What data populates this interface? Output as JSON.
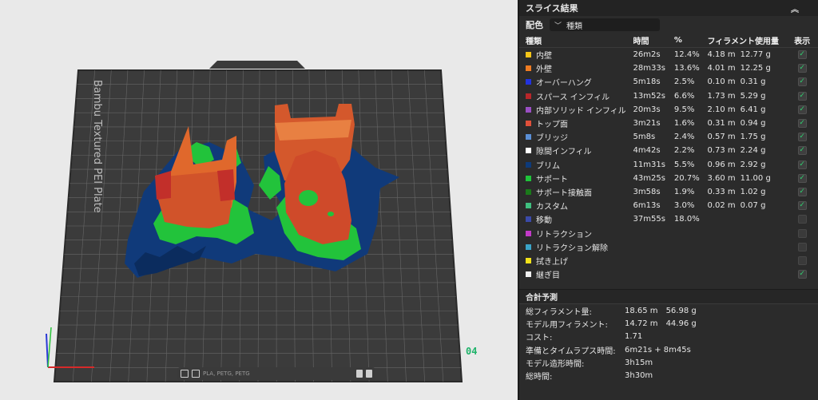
{
  "viewport": {
    "plate_label": "Bambu Textured PEI Plate",
    "plate_number": "04",
    "toolbar_text": "PLA, PETG, PETG"
  },
  "panel": {
    "title": "スライス結果",
    "scheme_label": "配色",
    "scheme_value": "種類",
    "headers": {
      "type": "種類",
      "time": "時間",
      "pct": "%",
      "filament": "フィラメント使用量",
      "show": "表示"
    },
    "rows": [
      {
        "name": "内壁",
        "color": "#f5c518",
        "time": "26m2s",
        "pct": "12.4%",
        "m": "4.18 m",
        "g": "12.77 g",
        "show": true
      },
      {
        "name": "外壁",
        "color": "#f07c22",
        "time": "28m33s",
        "pct": "13.6%",
        "m": "4.01 m",
        "g": "12.25 g",
        "show": true
      },
      {
        "name": "オーバーハング",
        "color": "#2233dd",
        "time": "5m18s",
        "pct": "2.5%",
        "m": "0.10 m",
        "g": "0.31 g",
        "show": true
      },
      {
        "name": "スパース インフィル",
        "color": "#b8262a",
        "time": "13m52s",
        "pct": "6.6%",
        "m": "1.73 m",
        "g": "5.29 g",
        "show": true
      },
      {
        "name": "内部ソリッド インフィル",
        "color": "#9a4fc4",
        "time": "20m3s",
        "pct": "9.5%",
        "m": "2.10 m",
        "g": "6.41 g",
        "show": true
      },
      {
        "name": "トップ面",
        "color": "#e0503a",
        "time": "3m21s",
        "pct": "1.6%",
        "m": "0.31 m",
        "g": "0.94 g",
        "show": true
      },
      {
        "name": "ブリッジ",
        "color": "#5a8fd6",
        "time": "5m8s",
        "pct": "2.4%",
        "m": "0.57 m",
        "g": "1.75 g",
        "show": true
      },
      {
        "name": "隙間インフィル",
        "color": "#ffffff",
        "time": "4m42s",
        "pct": "2.2%",
        "m": "0.73 m",
        "g": "2.24 g",
        "show": true
      },
      {
        "name": "ブリム",
        "color": "#0d3a7a",
        "time": "11m31s",
        "pct": "5.5%",
        "m": "0.96 m",
        "g": "2.92 g",
        "show": true
      },
      {
        "name": "サポート",
        "color": "#1fc43a",
        "time": "43m25s",
        "pct": "20.7%",
        "m": "3.60 m",
        "g": "11.00 g",
        "show": true
      },
      {
        "name": "サポート接触面",
        "color": "#1a7a1a",
        "time": "3m58s",
        "pct": "1.9%",
        "m": "0.33 m",
        "g": "1.02 g",
        "show": true
      },
      {
        "name": "カスタム",
        "color": "#3fbf7f",
        "time": "6m13s",
        "pct": "3.0%",
        "m": "0.02 m",
        "g": "0.07 g",
        "show": true
      },
      {
        "name": "移動",
        "color": "#3a4aa8",
        "time": "37m55s",
        "pct": "18.0%",
        "m": "",
        "g": "",
        "show": false
      },
      {
        "name": "リトラクション",
        "color": "#c23ac8",
        "time": "",
        "pct": "",
        "m": "",
        "g": "",
        "show": false
      },
      {
        "name": "リトラクション解除",
        "color": "#3aa4c8",
        "time": "",
        "pct": "",
        "m": "",
        "g": "",
        "show": false
      },
      {
        "name": "拭き上げ",
        "color": "#f2e21a",
        "time": "",
        "pct": "",
        "m": "",
        "g": "",
        "show": false
      },
      {
        "name": "継ぎ目",
        "color": "#f0f0f0",
        "time": "",
        "pct": "",
        "m": "",
        "g": "",
        "show": true
      }
    ],
    "summary_title": "合計予測",
    "summary": [
      {
        "label": "総フィラメント量:",
        "v1": "18.65 m",
        "v2": "56.98 g"
      },
      {
        "label": "モデル用フィラメント:",
        "v1": "14.72 m",
        "v2": "44.96 g"
      },
      {
        "label": "コスト:",
        "v1": "1.71",
        "v2": ""
      },
      {
        "label": "準備とタイムラプス時間:",
        "v1": "6m21s + 8m45s",
        "v2": ""
      },
      {
        "label": "モデル造形時間:",
        "v1": "3h15m",
        "v2": ""
      },
      {
        "label": "総時間:",
        "v1": "3h30m",
        "v2": ""
      }
    ]
  }
}
